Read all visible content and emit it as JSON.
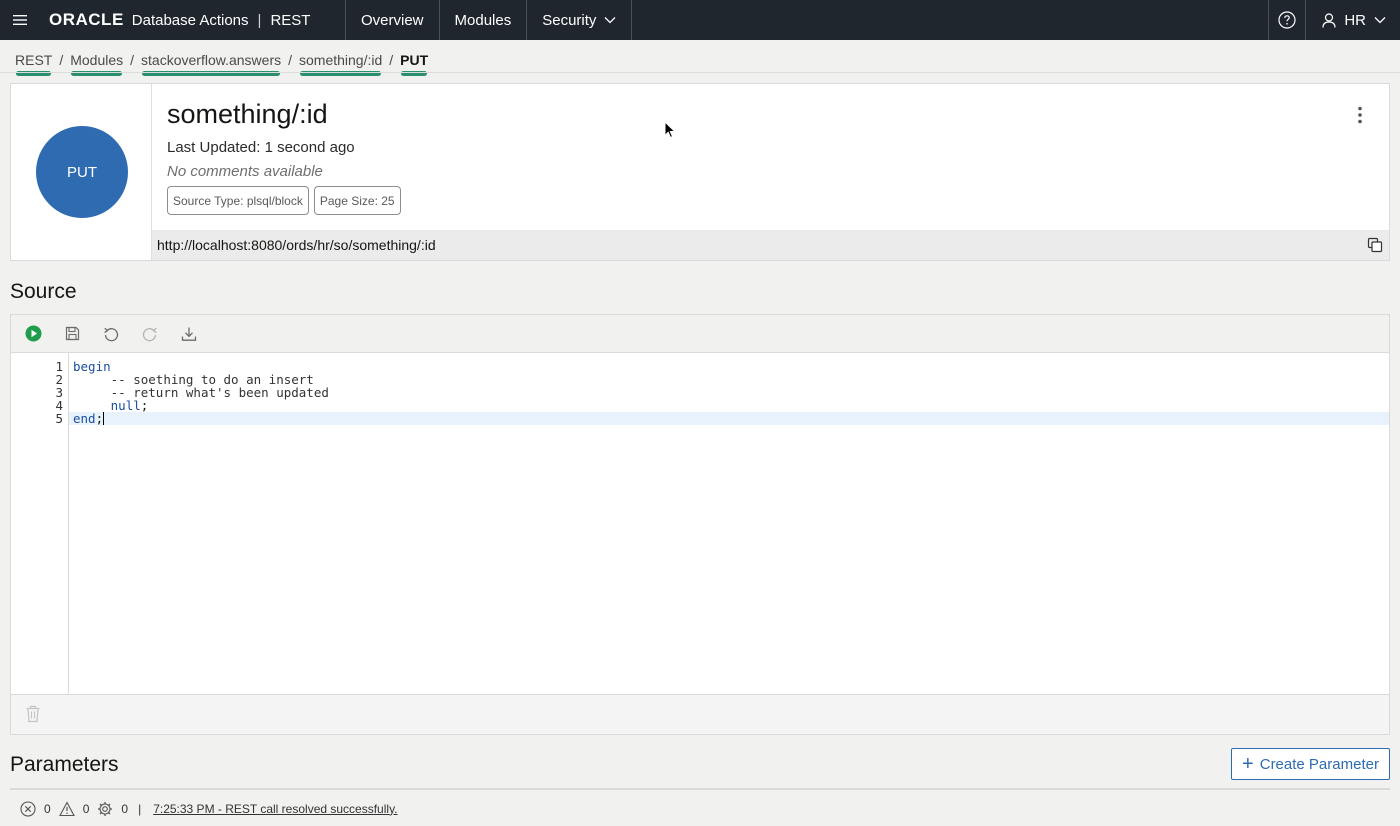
{
  "header": {
    "brand_logo": "ORACLE",
    "product": "Database Actions",
    "separator": "|",
    "section": "REST",
    "nav": [
      "Overview",
      "Modules",
      "Security"
    ],
    "user": "HR"
  },
  "breadcrumb": {
    "items": [
      "REST",
      "Modules",
      "stackoverflow.answers",
      "something/:id",
      "PUT"
    ],
    "separator": "/"
  },
  "handler": {
    "method": "PUT",
    "method_color": "#2f6bb0",
    "title": "something/:id",
    "last_updated": "Last Updated: 1 second ago",
    "comments": "No comments available",
    "source_type_chip": "Source Type: plsql/block",
    "page_size_chip": "Page Size: 25",
    "url": "http://localhost:8080/ords/hr/so/something/:id"
  },
  "source": {
    "title": "Source",
    "toolbar_icons": [
      "run-icon",
      "save-icon",
      "undo-icon",
      "redo-icon",
      "download-icon"
    ],
    "line_numbers": [
      "1",
      "2",
      "3",
      "4",
      "5"
    ],
    "lines": [
      {
        "indent": "",
        "keyword": "begin",
        "text": ""
      },
      {
        "indent": "     ",
        "keyword": "",
        "text": "-- soething to do an insert"
      },
      {
        "indent": "     ",
        "keyword": "",
        "text": "-- return what's been updated"
      },
      {
        "indent": "     ",
        "keyword": "null",
        "text": ";"
      },
      {
        "indent": "",
        "keyword": "end",
        "text": ";"
      }
    ]
  },
  "parameters": {
    "title": "Parameters",
    "create_button": "Create Parameter"
  },
  "status": {
    "errors": "0",
    "warnings": "0",
    "tasks": "0",
    "separator": "|",
    "message": "7:25:33 PM - REST call resolved successfully."
  }
}
